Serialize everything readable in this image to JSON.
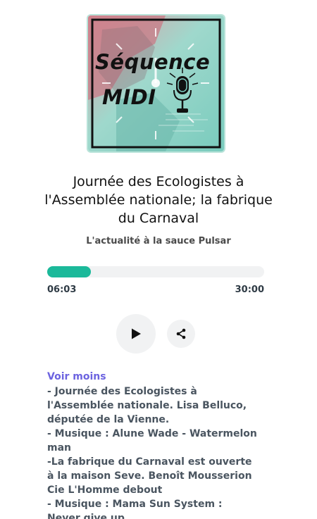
{
  "cover": {
    "line1": "Séquence",
    "line2": "MIDI",
    "icon": "microphone-icon"
  },
  "episode": {
    "title": "Journée des Ecologistes à l'Assemblée nationale; la fabrique du Carnaval",
    "subtitle": "L'actualité à la sauce Pulsar"
  },
  "player": {
    "current_time": "06:03",
    "total_time": "30:00",
    "progress_fraction": 0.2017,
    "play_icon": "play-icon",
    "share_icon": "share-icon"
  },
  "description": {
    "toggle_label": "Voir moins",
    "lines": [
      "- Journée des Ecologistes à l'Assemblée nationale. Lisa Belluco, députée de la Vienne.",
      "- Musique : Alune Wade - Watermelon man",
      "-La fabrique du Carnaval est ouverte à la maison Seve. Benoît Mousserion Cie L'Homme debout",
      "- Musique : Mama Sun System : Never give up"
    ]
  },
  "colors": {
    "accent": "#1bb99a",
    "link": "#6c63e0",
    "button_bg": "#f1f2f3",
    "cover_teal": "#7fcfc3",
    "cover_red": "#d9848f"
  }
}
